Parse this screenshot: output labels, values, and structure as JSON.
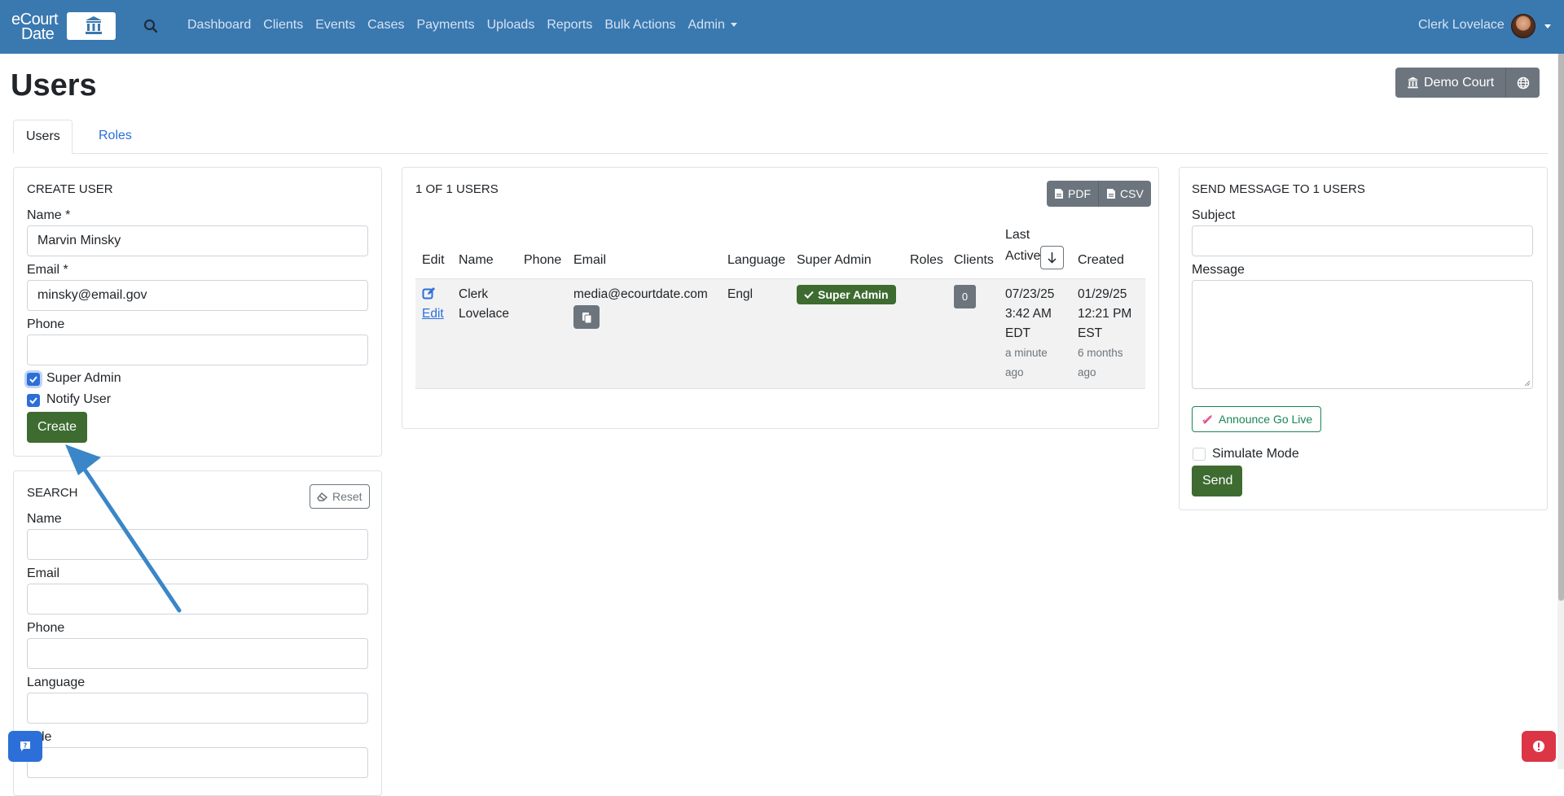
{
  "navbar": {
    "brand_line1": "eCourt",
    "brand_line2": "Date",
    "links": [
      "Dashboard",
      "Clients",
      "Events",
      "Cases",
      "Payments",
      "Uploads",
      "Reports",
      "Bulk Actions",
      "Admin"
    ],
    "user_name": "Clerk Lovelace"
  },
  "header": {
    "title": "Users",
    "court_label": "Demo Court"
  },
  "tabs": {
    "users": "Users",
    "roles": "Roles"
  },
  "create_user": {
    "title": "CREATE USER",
    "name_label": "Name *",
    "name_value": "Marvin Minsky",
    "email_label": "Email *",
    "email_value": "minsky@email.gov",
    "phone_label": "Phone",
    "phone_value": "",
    "super_admin_label": "Super Admin",
    "super_admin_checked": true,
    "notify_label": "Notify User",
    "notify_checked": true,
    "create_button": "Create"
  },
  "search": {
    "title": "SEARCH",
    "reset_button": "Reset",
    "name_label": "Name",
    "email_label": "Email",
    "phone_label": "Phone",
    "language_label": "Language",
    "role_label_partial": "le"
  },
  "users_table": {
    "count_title": "1 OF 1 USERS",
    "pdf_label": "PDF",
    "csv_label": "CSV",
    "headers": {
      "edit": "Edit",
      "name": "Name",
      "phone": "Phone",
      "email": "Email",
      "language": "Language",
      "super_admin": "Super Admin",
      "roles": "Roles",
      "clients": "Clients",
      "last_active_1": "Last",
      "last_active_2": "Active",
      "created": "Created"
    },
    "row": {
      "edit_link": "Edit",
      "name_first": "Clerk",
      "name_last": "Lovelace",
      "phone": "",
      "email": "media@ecourtdate.com",
      "language": "Engl",
      "super_admin_badge": "Super Admin",
      "clients": "0",
      "last_active_date": "07/23/25",
      "last_active_time": "3:42 AM",
      "last_active_tz": "EDT",
      "last_active_rel_1": "a minute",
      "last_active_rel_2": "ago",
      "created_date": "01/29/25",
      "created_time": "12:21 PM",
      "created_tz": "EST",
      "created_rel_1": "6 months",
      "created_rel_2": "ago"
    }
  },
  "send_message": {
    "title": "SEND MESSAGE TO 1 USERS",
    "subject_label": "Subject",
    "subject_value": "",
    "message_label": "Message",
    "announce_button": "Announce Go Live",
    "simulate_label": "Simulate Mode",
    "simulate_checked": false,
    "send_button": "Send"
  },
  "colors": {
    "navbar": "#3a78b0",
    "primary_green": "#3d6b30",
    "link_blue": "#2b6fdc",
    "secondary": "#6c757d",
    "arrow": "#3a86c8",
    "danger": "#dc3545"
  }
}
